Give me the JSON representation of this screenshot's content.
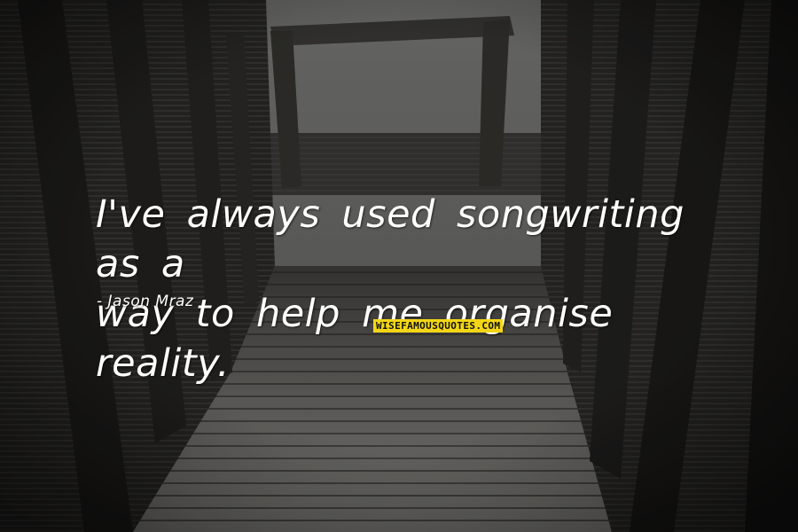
{
  "quote": {
    "line1": "I've always used songwriting as a",
    "line2": "way to help me organise reality.",
    "author": "- Jason Mraz"
  },
  "watermark": {
    "text": "WISEFAMOUSQUOTES.COM",
    "background": "#f2d616"
  },
  "colors": {
    "text": "#ffffff",
    "sky": "#6f6f6d",
    "wood_dark": "#2a2927",
    "wood_light": "#8a8985"
  }
}
